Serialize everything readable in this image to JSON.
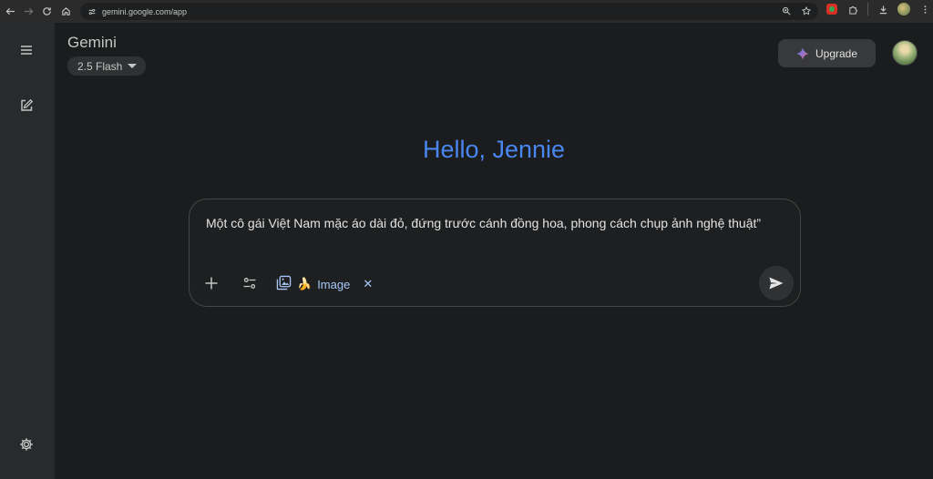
{
  "browser": {
    "url": "gemini.google.com/app"
  },
  "app": {
    "title": "Gemini",
    "model": "2.5 Flash",
    "upgrade_label": "Upgrade"
  },
  "greeting": "Hello, Jennie",
  "prompt": {
    "text": "Một cô gái Việt Nam mặc áo dài đỏ, đứng trước cánh đồng hoa, phong cách chụp ảnh nghệ thuật”",
    "chip_emoji": "🍌",
    "chip_label": "Image",
    "chip_close": "✕"
  },
  "colors": {
    "accent": "#4a86f0",
    "chip": "#a8c7fa",
    "background": "#1b1c1d",
    "rail": "#282a2c"
  },
  "icons": [
    "back-icon",
    "forward-icon",
    "reload-icon",
    "home-icon",
    "site-info-icon",
    "zoom-icon",
    "star-icon",
    "extensions-icon",
    "download-icon",
    "kebab-menu-icon",
    "hamburger-menu-icon",
    "new-chat-icon",
    "settings-icon",
    "sparkle-icon",
    "plus-icon",
    "tools-icon",
    "image-gen-icon",
    "send-icon"
  ]
}
